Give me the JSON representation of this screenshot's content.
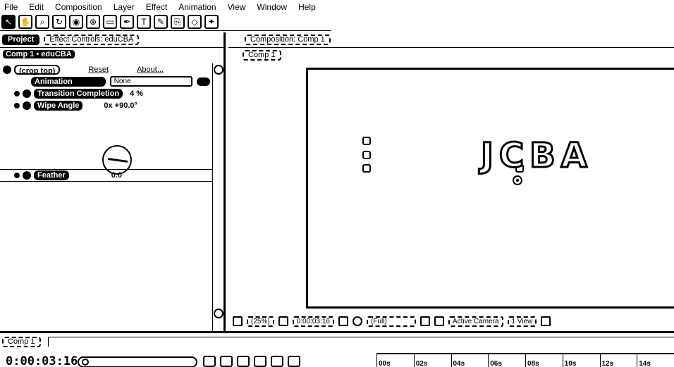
{
  "menu": [
    "File",
    "Edit",
    "Composition",
    "Layer",
    "Effect",
    "Animation",
    "View",
    "Window",
    "Help"
  ],
  "left_panel": {
    "tabs": [
      "Project",
      "Effect Controls: eduCBA"
    ],
    "header": "Comp 1 • eduCBA",
    "effect_name": "(crop top)",
    "reset_label": "Reset",
    "about_label": "About...",
    "presets_label": "Animation Presets:",
    "presets_value": "None",
    "props": [
      {
        "name": "Transition Completion",
        "value": "4 %"
      },
      {
        "name": "Wipe Angle",
        "value": "0x +90.0°"
      },
      {
        "name": "Feather",
        "value": "0.0"
      }
    ]
  },
  "right_panel": {
    "tab": "Composition: Comp 1",
    "sub_tab": "Comp 1",
    "viewer_text": "JCBA",
    "viewbar": [
      "(25%)",
      "0:00:03:16",
      "(Full)",
      "Active Camera",
      "1 View"
    ]
  },
  "timeline": {
    "tab": "Comp 1",
    "timecode": "0:00:03:16",
    "ruler": [
      "00s",
      "02s",
      "04s",
      "06s",
      "08s",
      "10s",
      "12s",
      "14s"
    ]
  }
}
